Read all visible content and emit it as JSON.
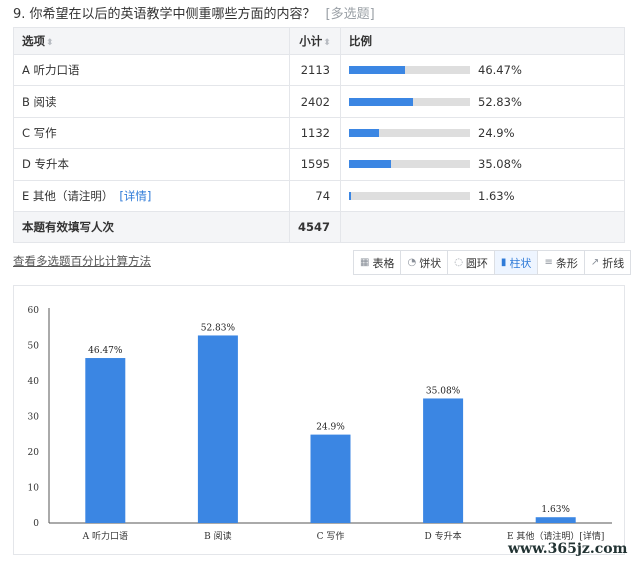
{
  "question": {
    "title": "9. 你希望在以后的英语教学中侧重哪些方面的内容？",
    "type_tag": "[多选题]"
  },
  "table": {
    "headers": {
      "option": "选项",
      "count": "小计",
      "ratio": "比例"
    },
    "rows": [
      {
        "option": "A 听力口语",
        "count": "2113",
        "ratio": "46.47%",
        "ratio_value": 46.47
      },
      {
        "option": "B 阅读",
        "count": "2402",
        "ratio": "52.83%",
        "ratio_value": 52.83
      },
      {
        "option": "C 写作",
        "count": "1132",
        "ratio": "24.9%",
        "ratio_value": 24.9
      },
      {
        "option": "D 专升本",
        "count": "1595",
        "ratio": "35.08%",
        "ratio_value": 35.08
      },
      {
        "option": "E 其他（请注明）",
        "detail": "[详情]",
        "count": "74",
        "ratio": "1.63%",
        "ratio_value": 1.63
      }
    ],
    "total": {
      "label": "本题有效填写人次",
      "count": "4547"
    }
  },
  "calc_link": "查看多选题百分比计算方法",
  "view_options": [
    {
      "label": "表格",
      "icon": "table-icon",
      "active": false
    },
    {
      "label": "饼状",
      "icon": "pie-icon",
      "active": false
    },
    {
      "label": "圆环",
      "icon": "ring-icon",
      "active": false
    },
    {
      "label": "柱状",
      "icon": "bar-chart-icon",
      "active": true
    },
    {
      "label": "条形",
      "icon": "hbar-icon",
      "active": false
    },
    {
      "label": "折线",
      "icon": "line-chart-icon",
      "active": false
    }
  ],
  "chart_data": {
    "type": "bar",
    "categories": [
      "A 听力口语",
      "B 阅读",
      "C 写作",
      "D 专升本",
      "E 其他（请注明）[详情]"
    ],
    "values": [
      46.47,
      52.83,
      24.9,
      35.08,
      1.63
    ],
    "value_labels": [
      "46.47%",
      "52.83%",
      "24.9%",
      "35.08%",
      "1.63%"
    ],
    "yticks": [
      "0",
      "10",
      "20",
      "30",
      "40",
      "50",
      "60"
    ],
    "ylim": [
      0,
      60
    ],
    "bar_color": "#3b86e3",
    "grid": false
  },
  "watermark": "www.365jz.com",
  "colors": {
    "accent": "#3b86e3",
    "link": "#2f7bd8"
  }
}
